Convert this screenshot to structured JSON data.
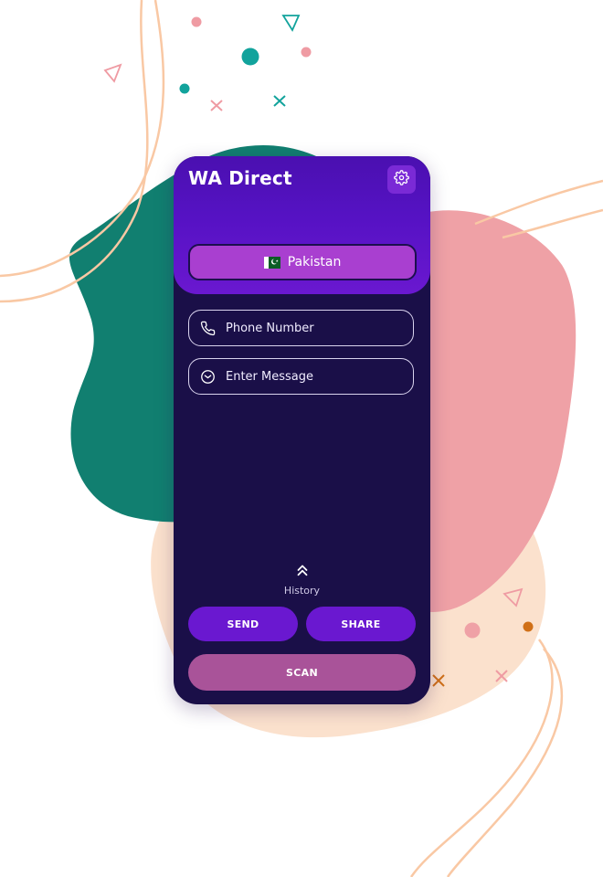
{
  "app": {
    "title": "WA Direct"
  },
  "country": {
    "label": "Pakistan",
    "flag_icon": "pakistan-flag-icon"
  },
  "phone_field": {
    "placeholder": "Phone Number",
    "icon": "phone-icon"
  },
  "message_field": {
    "placeholder": "Enter Message",
    "icon": "message-icon"
  },
  "history": {
    "label": "History",
    "icon": "double-chevron-up-icon"
  },
  "actions": {
    "send_label": "SEND",
    "share_label": "SHARE",
    "scan_label": "SCAN"
  },
  "colors": {
    "phone_body": "#1a0f48",
    "header": "#5612c4",
    "country_button": "#a93fd0",
    "action_button": "#6a18d0",
    "scan_button": "#a95399",
    "blob_teal": "#117f70",
    "blob_pink": "#efa1a6",
    "blob_peach": "#fbe1cd"
  }
}
